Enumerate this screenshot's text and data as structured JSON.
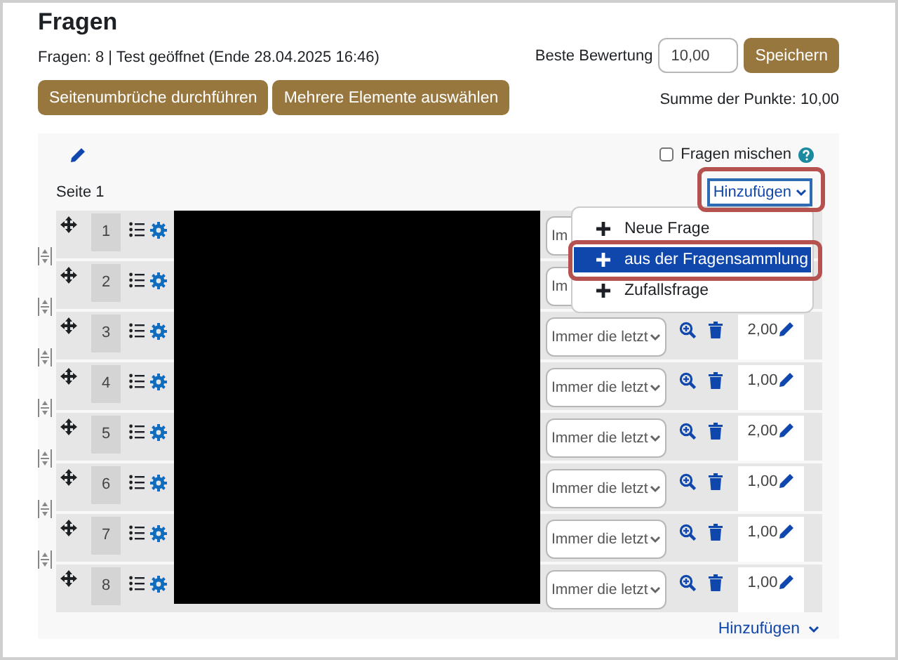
{
  "page_title": "Fragen",
  "summary": "Fragen: 8 | Test geöffnet (Ende 28.04.2025 16:46)",
  "max_grade": {
    "label": "Beste Bewertung",
    "value": "10,00",
    "button": "Speichern"
  },
  "action_buttons": [
    "Seitenumbrüche durchführen",
    "Mehrere Elemente auswählen"
  ],
  "total": "Summe der Punkte: 10,00",
  "shuffle": {
    "label": "Fragen mischen",
    "checked": false
  },
  "page_label": "Seite 1",
  "add_button": {
    "label": "Hinzufügen",
    "expanded": true,
    "highlighted": true
  },
  "add_menu": [
    {
      "label": "Neue Frage",
      "selected": false,
      "highlighted": false
    },
    {
      "label": "aus der Fragensammlung",
      "selected": true,
      "highlighted": true
    },
    {
      "label": "Zufallsfrage",
      "selected": false,
      "highlighted": false
    }
  ],
  "questions": [
    {
      "number": "1",
      "behaviour": "Im"
    },
    {
      "number": "2",
      "behaviour": "Im"
    },
    {
      "number": "3",
      "behaviour": "Immer die letzt",
      "points": "2,00"
    },
    {
      "number": "4",
      "behaviour": "Immer die letzt",
      "points": "1,00"
    },
    {
      "number": "5",
      "behaviour": "Immer die letzt",
      "points": "2,00"
    },
    {
      "number": "6",
      "behaviour": "Immer die letzt",
      "points": "1,00"
    },
    {
      "number": "7",
      "behaviour": "Immer die letzt",
      "points": "1,00"
    },
    {
      "number": "8",
      "behaviour": "Immer die letzt",
      "points": "1,00"
    }
  ],
  "footer_add": "Hinzufügen"
}
